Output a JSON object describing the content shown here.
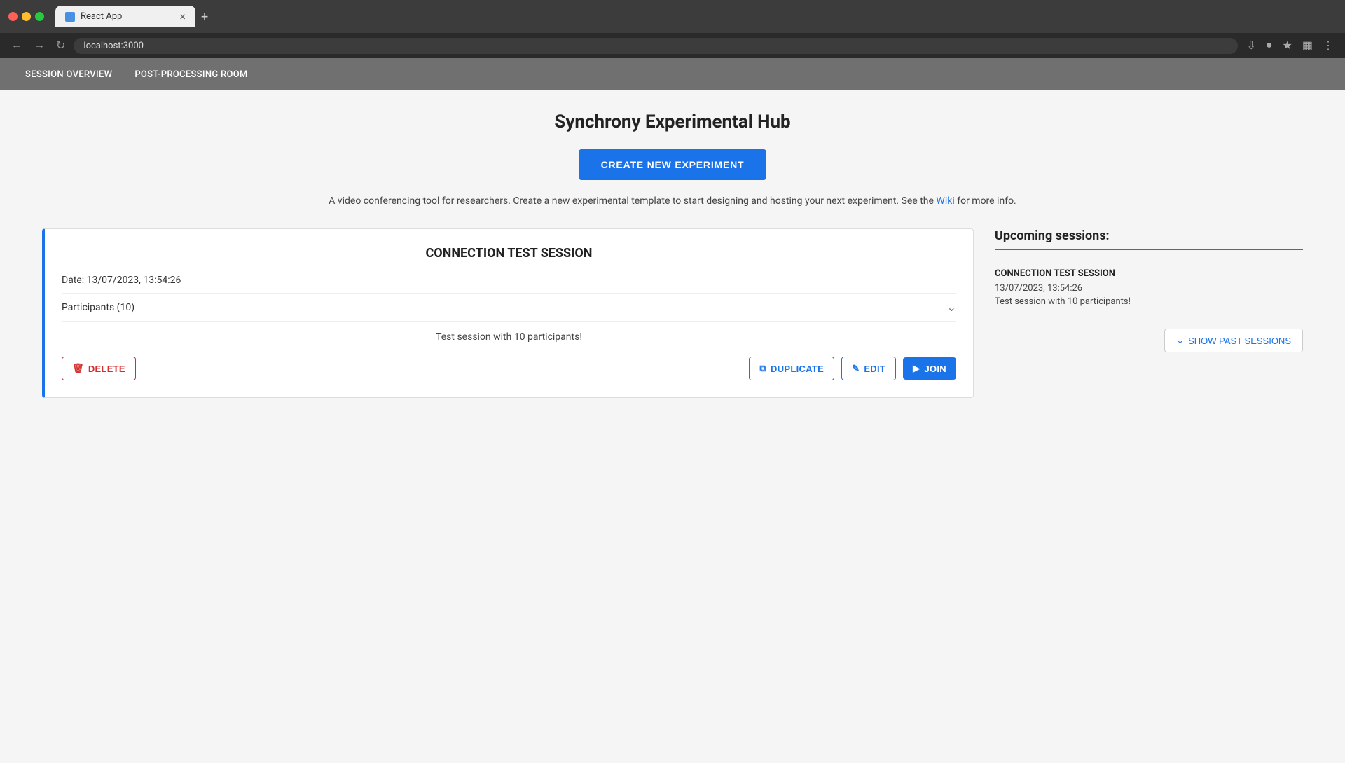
{
  "browser": {
    "tab_title": "React App",
    "url": "localhost:3000"
  },
  "nav": {
    "items": [
      {
        "label": "SESSION OVERVIEW"
      },
      {
        "label": "POST-PROCESSING ROOM"
      }
    ]
  },
  "page": {
    "title": "Synchrony Experimental Hub",
    "create_button_label": "CREATE NEW EXPERIMENT",
    "description": "A video conferencing tool for researchers. Create a new experimental template to start designing and hosting your next experiment. See the",
    "wiki_link_text": "Wiki",
    "description_suffix": "for more info."
  },
  "session_card": {
    "title": "CONNECTION TEST SESSION",
    "date_label": "Date: 13/07/2023, 13:54:26",
    "participants_label": "Participants (10)",
    "description": "Test session with 10 participants!",
    "delete_label": "DELETE",
    "duplicate_label": "DUPLICATE",
    "edit_label": "EDIT",
    "join_label": "JOIN"
  },
  "upcoming": {
    "title": "Upcoming sessions:",
    "sessions": [
      {
        "name": "CONNECTION TEST SESSION",
        "date": "13/07/2023, 13:54:26",
        "description": "Test session with 10 participants!"
      }
    ],
    "show_past_label": "SHOW PAST SESSIONS"
  }
}
